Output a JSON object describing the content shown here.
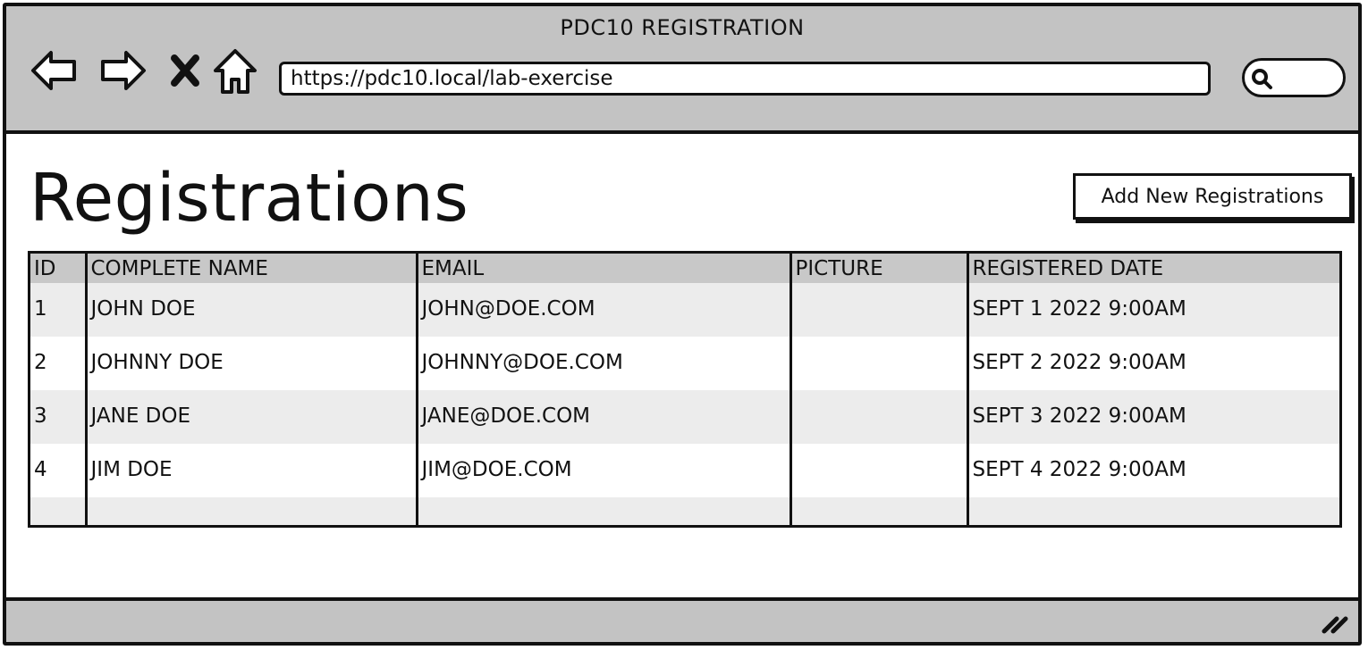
{
  "window": {
    "title": "PDC10 REGISTRATION"
  },
  "toolbar": {
    "back_icon": "arrow-left-icon",
    "forward_icon": "arrow-right-icon",
    "stop_icon": "close-icon",
    "home_icon": "home-icon",
    "url": "https://pdc10.local/lab-exercise",
    "search_icon": "search-icon"
  },
  "page": {
    "title": "Registrations",
    "add_button_label": "Add New Registrations"
  },
  "table": {
    "columns": [
      "ID",
      "COMPLETE NAME",
      "EMAIL",
      "PICTURE",
      "REGISTERED DATE"
    ],
    "rows": [
      {
        "id": "1",
        "name": "JOHN DOE",
        "email": "JOHN@DOE.COM",
        "picture": "",
        "date": "SEPT 1 2022 9:00AM"
      },
      {
        "id": "2",
        "name": "JOHNNY DOE",
        "email": "JOHNNY@DOE.COM",
        "picture": "",
        "date": "SEPT 2 2022 9:00AM"
      },
      {
        "id": "3",
        "name": "JANE DOE",
        "email": "JANE@DOE.COM",
        "picture": "",
        "date": "SEPT 3 2022 9:00AM"
      },
      {
        "id": "4",
        "name": "JIM DOE",
        "email": "JIM@DOE.COM",
        "picture": "",
        "date": "SEPT 4 2022 9:00AM"
      }
    ]
  },
  "statusbar": {
    "resize_icon": "resize-grip-icon"
  }
}
